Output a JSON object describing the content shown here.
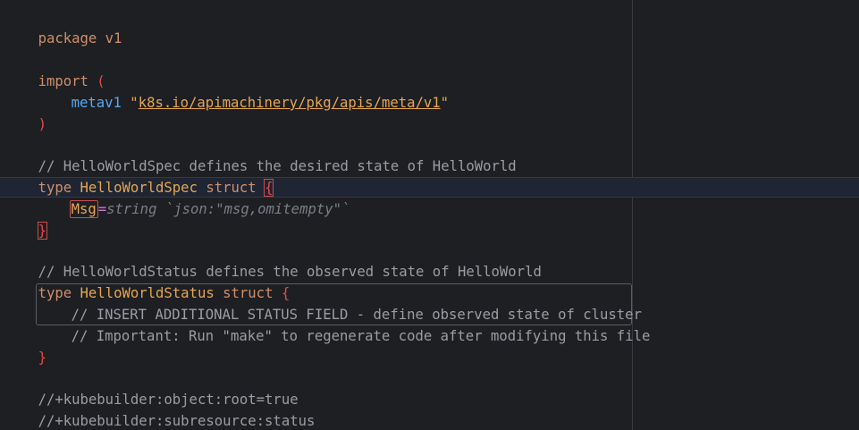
{
  "code": {
    "package_keyword": "package",
    "package_name": "v1",
    "import_keyword": "import",
    "import_open": "(",
    "import_alias": "metav1",
    "import_quote_open": "\"",
    "import_path": "k8s.io/apimachinery/pkg/apis/meta/v1",
    "import_quote_close": "\"",
    "import_close": ")",
    "spec_comment": "// HelloWorldSpec defines the desired state of HelloWorld",
    "type_keyword": "type",
    "spec_type_name": "HelloWorldSpec",
    "struct_keyword": "struct",
    "open_brace": "{",
    "close_brace": "}",
    "spec_field_name": "Msg",
    "spec_field_hint_mark": "=",
    "spec_field_type": "string",
    "spec_field_tag": "`json:\"msg,omitempty\"`",
    "status_comment": "// HelloWorldStatus defines the observed state of HelloWorld",
    "status_type_name": "HelloWorldStatus",
    "status_comment_1": "// INSERT ADDITIONAL STATUS FIELD - define observed state of cluster",
    "status_comment_2": "// Important: Run \"make\" to regenerate code after modifying this file",
    "marker_1": "//+kubebuilder:object:root=true",
    "marker_2": "//+kubebuilder:subresource:status"
  },
  "colors": {
    "background": "#1e1f22",
    "keyword": "#cf8e6d",
    "type_name": "#e5a653",
    "comment": "#9a9da3",
    "brace_highlight": "#e34b4b",
    "alias": "#56a8f5"
  }
}
